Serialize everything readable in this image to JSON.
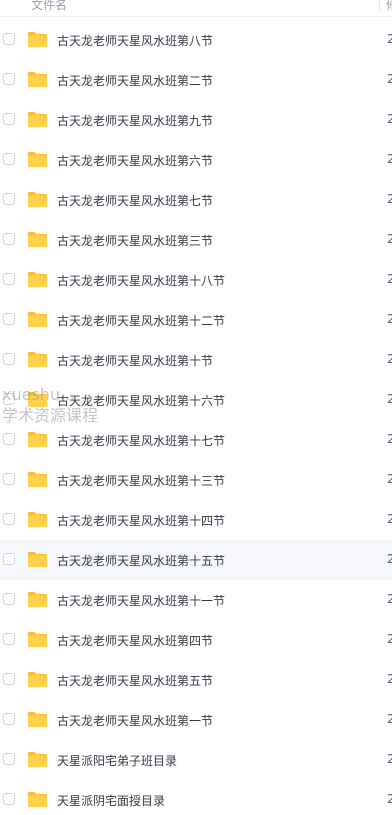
{
  "header": {
    "name_label": "文件名",
    "right_label": "修"
  },
  "rows": [
    {
      "name": "古天龙老师天星风水班第八节",
      "date": "2"
    },
    {
      "name": "古天龙老师天星风水班第二节",
      "date": "2"
    },
    {
      "name": "古天龙老师天星风水班第九节",
      "date": "2"
    },
    {
      "name": "古天龙老师天星风水班第六节",
      "date": "2"
    },
    {
      "name": "古天龙老师天星风水班第七节",
      "date": "2"
    },
    {
      "name": "古天龙老师天星风水班第三节",
      "date": "2"
    },
    {
      "name": "古天龙老师天星风水班第十八节",
      "date": "2"
    },
    {
      "name": "古天龙老师天星风水班第十二节",
      "date": "2"
    },
    {
      "name": "古天龙老师天星风水班第十节",
      "date": "2"
    },
    {
      "name": "古天龙老师天星风水班第十六节",
      "date": "2"
    },
    {
      "name": "古天龙老师天星风水班第十七节",
      "date": "2"
    },
    {
      "name": "古天龙老师天星风水班第十三节",
      "date": "2"
    },
    {
      "name": "古天龙老师天星风水班第十四节",
      "date": "2"
    },
    {
      "name": "古天龙老师天星风水班第十五节",
      "date": "2"
    },
    {
      "name": "古天龙老师天星风水班第十一节",
      "date": "2"
    },
    {
      "name": "古天龙老师天星风水班第四节",
      "date": "2"
    },
    {
      "name": "古天龙老师天星风水班第五节",
      "date": "2"
    },
    {
      "name": "古天龙老师天星风水班第一节",
      "date": "2"
    },
    {
      "name": "天星派阳宅弟子班目录",
      "date": "2"
    },
    {
      "name": "天星派阴宅面授目录",
      "date": "2"
    }
  ],
  "watermark": {
    "line1": "xueshu...",
    "line2": "学术资源课程"
  },
  "colors": {
    "folder": "#ffd04b",
    "folder_tab": "#f7bf2a",
    "hover_row": "#f5f7fc"
  },
  "icons": {
    "folder": "folder-icon",
    "checkbox": "checkbox"
  }
}
